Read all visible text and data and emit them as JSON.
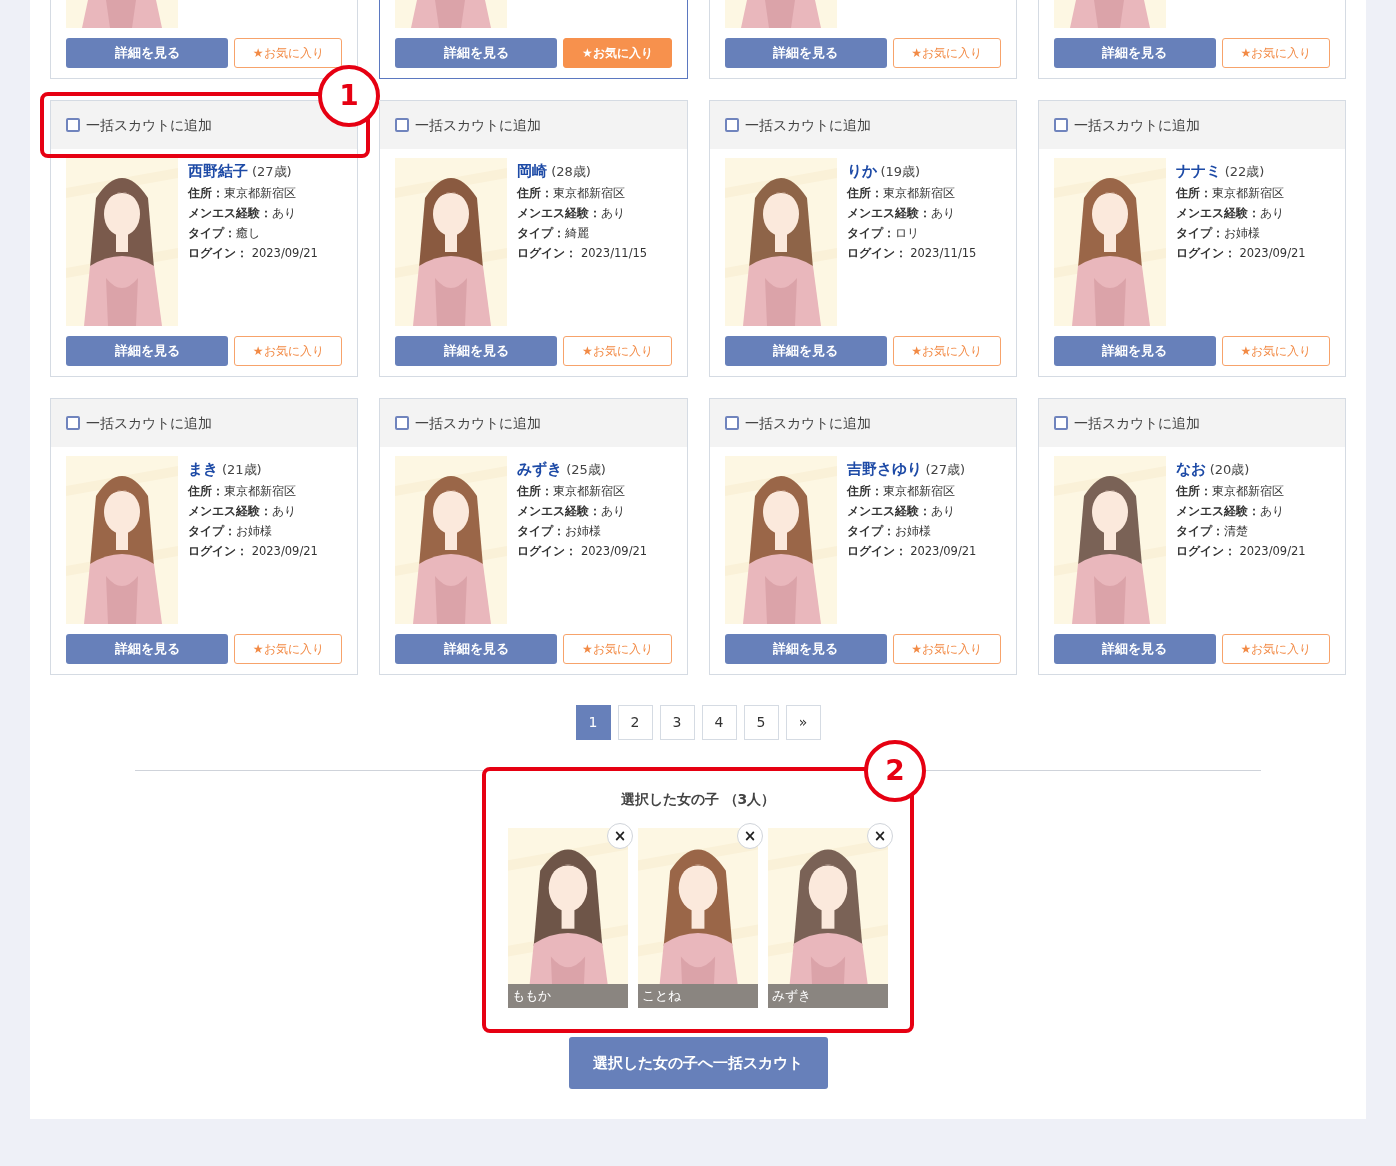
{
  "top_row": [
    {
      "detail_button": "詳細を見る",
      "favorite_button": "★お気に入り",
      "favorite": false
    },
    {
      "detail_button": "詳細を見る",
      "favorite_button": "★お気に入り",
      "favorite": true
    },
    {
      "detail_button": "詳細を見る",
      "favorite_button": "★お気に入り",
      "favorite": false
    },
    {
      "detail_button": "詳細を見る",
      "favorite_button": "★お気に入り",
      "favorite": false
    }
  ],
  "cards": [
    {
      "checkbox_label": "一括スカウトに追加",
      "checked": false,
      "name": "西野結子",
      "age": "(27歳)",
      "details": [
        "**住所：**東京都新宿区",
        "**メンエス経験：**あり",
        "**タイプ：**癒し",
        "**ログイン：** 2023/09/21"
      ],
      "detail_button": "詳細を見る",
      "favorite_button": "★お気に入り",
      "favorite": false
    },
    {
      "checkbox_label": "一括スカウトに追加",
      "checked": false,
      "name": "岡崎",
      "age": "(28歳)",
      "details": [
        "**住所：**東京都新宿区",
        "**メンエス経験：**あり",
        "**タイプ：**綺麗",
        "**ログイン：** 2023/11/15"
      ],
      "detail_button": "詳細を見る",
      "favorite_button": "★お気に入り",
      "favorite": false
    },
    {
      "checkbox_label": "一括スカウトに追加",
      "checked": false,
      "name": "りか",
      "age": "(19歳)",
      "details": [
        "**住所：**東京都新宿区",
        "**メンエス経験：**あり",
        "**タイプ：**ロリ",
        "**ログイン：** 2023/11/15"
      ],
      "detail_button": "詳細を見る",
      "favorite_button": "★お気に入り",
      "favorite": false
    },
    {
      "checkbox_label": "一括スカウトに追加",
      "checked": false,
      "name": "ナナミ",
      "age": "(22歳)",
      "details": [
        "**住所：**東京都新宿区",
        "**メンエス経験：**あり",
        "**タイプ：**お姉様",
        "**ログイン：** 2023/09/21"
      ],
      "detail_button": "詳細を見る",
      "favorite_button": "★お気に入り",
      "favorite": false
    },
    {
      "checkbox_label": "一括スカウトに追加",
      "checked": false,
      "name": "まき",
      "age": "(21歳)",
      "details": [
        "**住所：**東京都新宿区",
        "**メンエス経験：**あり",
        "**タイプ：**お姉様",
        "**ログイン：** 2023/09/21"
      ],
      "detail_button": "詳細を見る",
      "favorite_button": "★お気に入り",
      "favorite": false
    },
    {
      "checkbox_label": "一括スカウトに追加",
      "checked": false,
      "name": "みずき",
      "age": "(25歳)",
      "details": [
        "**住所：**東京都新宿区",
        "**メンエス経験：**あり",
        "**タイプ：**お姉様",
        "**ログイン：** 2023/09/21"
      ],
      "detail_button": "詳細を見る",
      "favorite_button": "★お気に入り",
      "favorite": false
    },
    {
      "checkbox_label": "一括スカウトに追加",
      "checked": false,
      "name": "吉野さゆり",
      "age": "(27歳)",
      "details": [
        "**住所：**東京都新宿区",
        "**メンエス経験：**あり",
        "**タイプ：**お姉様",
        "**ログイン：** 2023/09/21"
      ],
      "detail_button": "詳細を見る",
      "favorite_button": "★お気に入り",
      "favorite": false
    },
    {
      "checkbox_label": "一括スカウトに追加",
      "checked": false,
      "name": "なお",
      "age": "(20歳)",
      "details": [
        "**住所：**東京都新宿区",
        "**メンエス経験：**あり",
        "**タイプ：**清楚",
        "**ログイン：** 2023/09/21"
      ],
      "detail_button": "詳細を見る",
      "favorite_button": "★お気に入り",
      "favorite": false
    }
  ],
  "pagination": [
    {
      "label": "1",
      "selected": true
    },
    {
      "label": "2",
      "selected": false
    },
    {
      "label": "3",
      "selected": false
    },
    {
      "label": "4",
      "selected": false
    },
    {
      "label": "5",
      "selected": false
    },
    {
      "label": "»",
      "selected": false
    }
  ],
  "selected_panel": {
    "title": "選択した女の子 （3人）",
    "girls": [
      {
        "name": "ももか",
        "remove": "×"
      },
      {
        "name": "ことね",
        "remove": "×"
      },
      {
        "name": "みずき",
        "remove": "×"
      }
    ]
  },
  "scout_button": "選択した女の子へ一括スカウト",
  "annotations": [
    "1",
    "2"
  ]
}
